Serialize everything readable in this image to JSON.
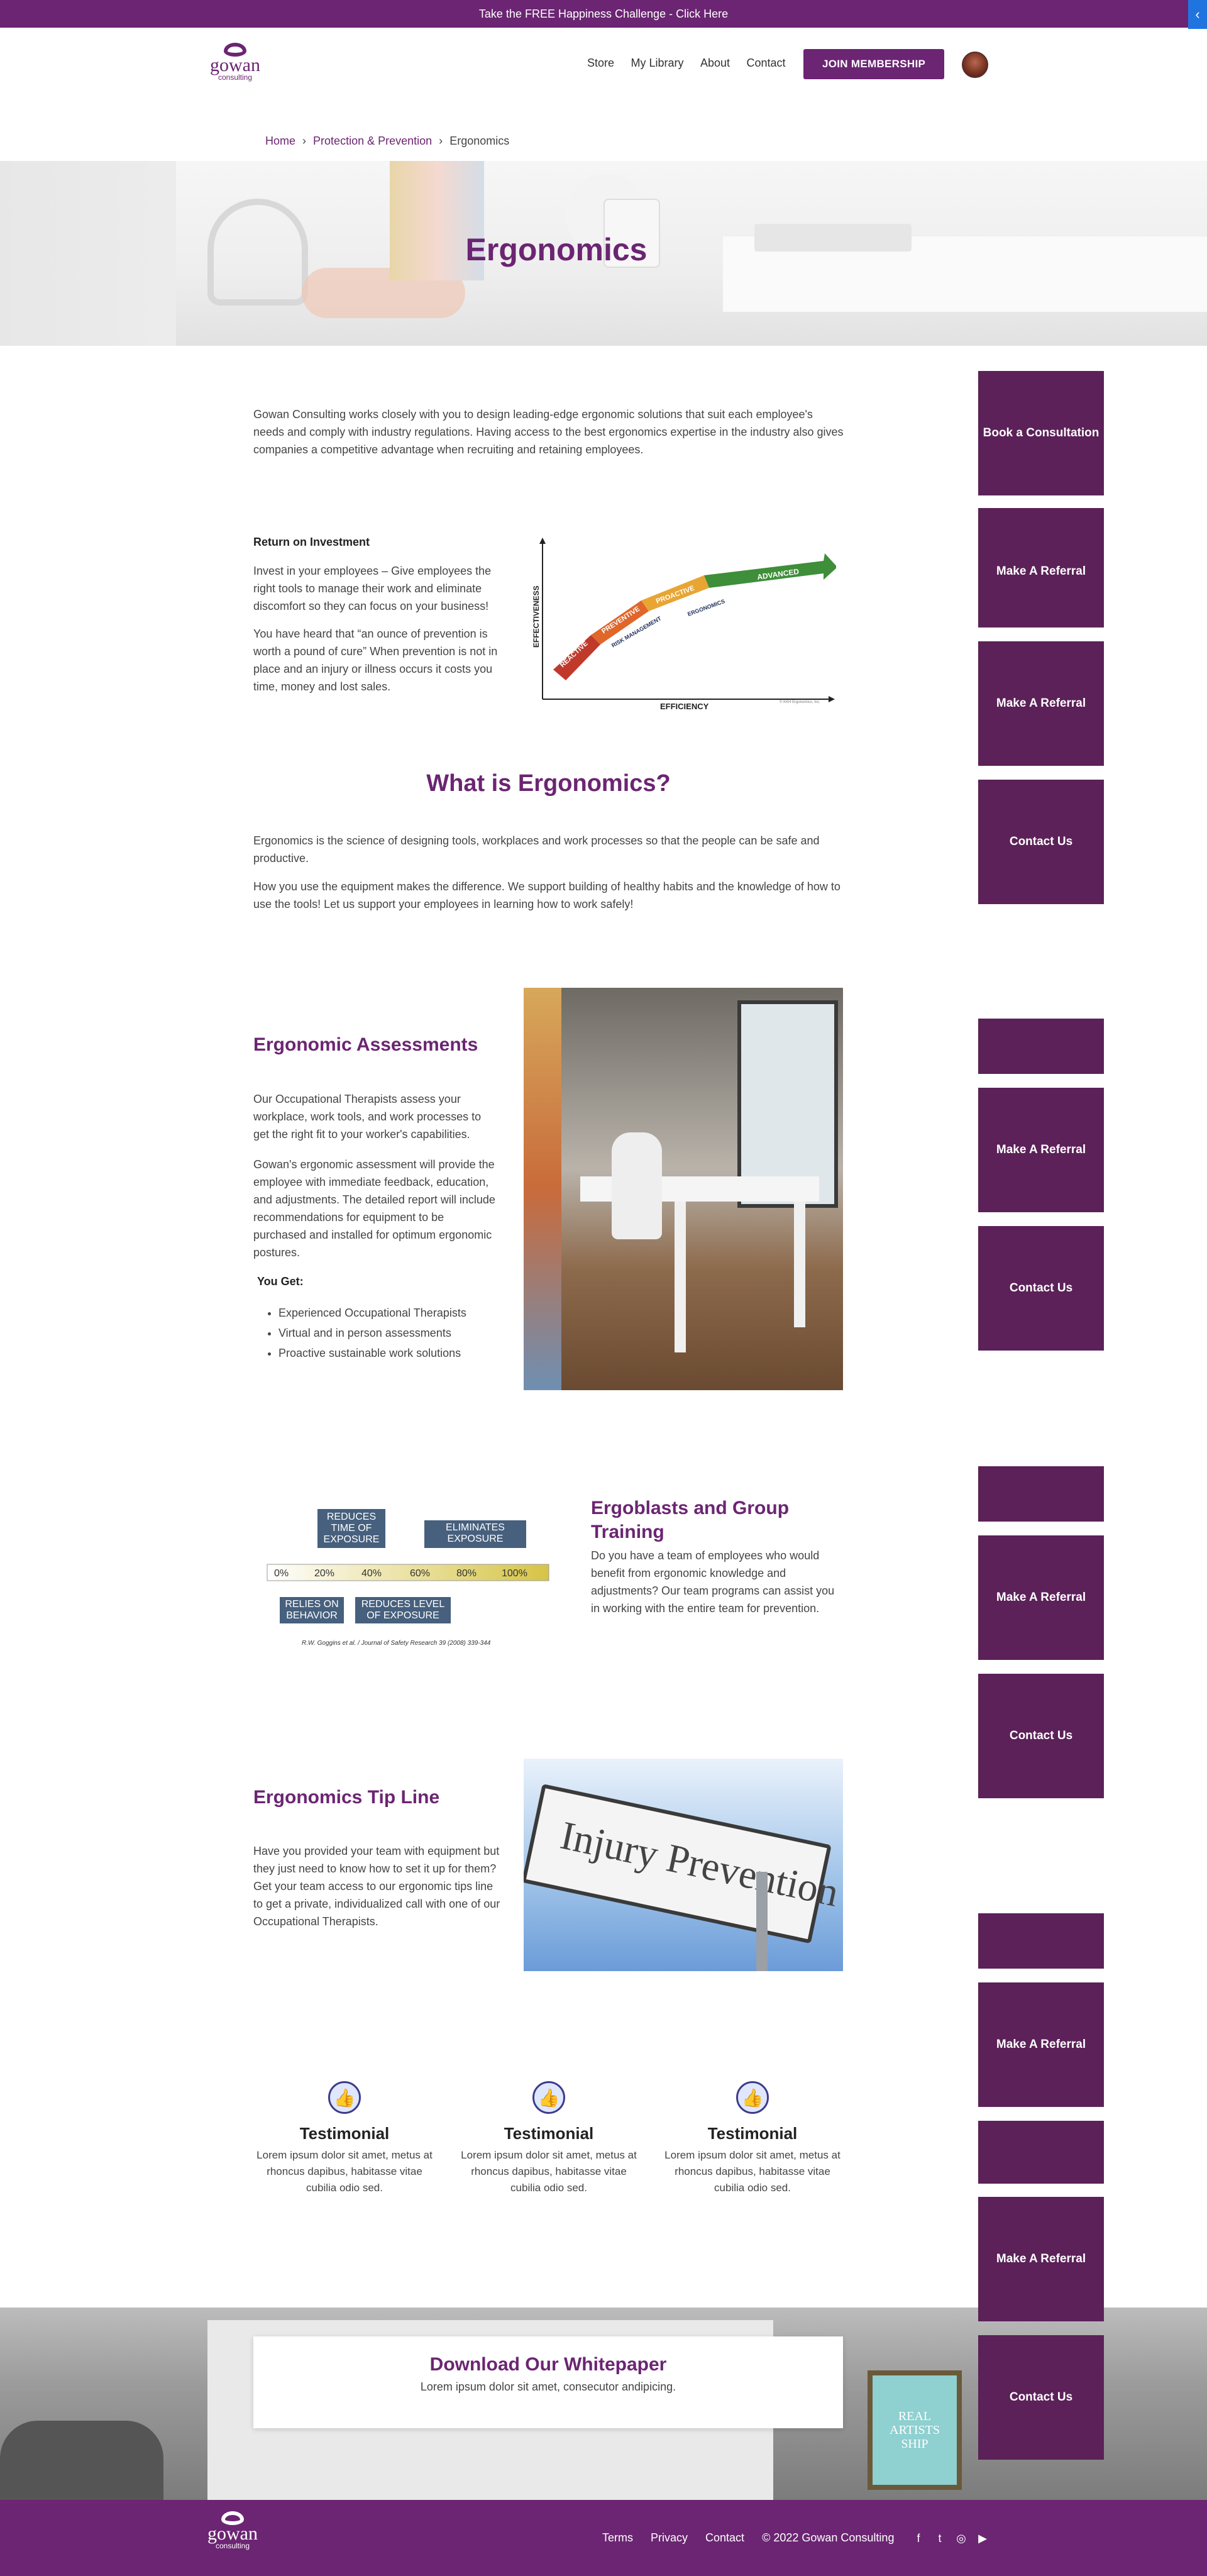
{
  "topbar": {
    "text": "Take the FREE Happiness Challenge - Click Here",
    "tab_glyph": "‹"
  },
  "logo": {
    "name": "gowan",
    "sub": "consulting"
  },
  "nav": {
    "items": [
      "Store",
      "My Library",
      "About",
      "Contact"
    ],
    "join_label": "JOIN MEMBERSHIP"
  },
  "breadcrumb": {
    "home": "Home",
    "parent": "Protection & Prevention",
    "current": "Ergonomics",
    "sep": "›"
  },
  "hero": {
    "title": "Ergonomics"
  },
  "intro": {
    "text": "Gowan Consulting works closely with you to design leading-edge ergonomic solutions that suit each employee's needs and comply with industry regulations. Having access to the best ergonomics expertise in the industry also gives companies a competitive advantage when recruiting and retaining employees."
  },
  "roi": {
    "heading": "Return on Investment",
    "p1": "Invest in your employees – Give employees the right tools to manage their work and eliminate discomfort so they can focus on your business!",
    "p2": "You have heard that “an ounce of prevention is worth a pound of cure”  When prevention is not in place and an injury or illness occurs it costs you time, money and lost sales.",
    "chart": {
      "ylabel": "EFFECTIVENESS",
      "xlabel": "EFFICIENCY",
      "stages": [
        "REACTIVE",
        "PREVENTIVE",
        "PROACTIVE",
        "ADVANCED"
      ],
      "tags": [
        "RISK MANAGEMENT",
        "ERGONOMICS"
      ],
      "credit": "© KKH Ergonomics, Inc."
    }
  },
  "what": {
    "title": "What is Ergonomics?",
    "p1": "Ergonomics is the science of designing tools, workplaces and work processes so that the people can be safe and productive.",
    "p2": "How you use the equipment makes the difference.  We support building of healthy habits and the knowledge of how to use the tools! Let us support your employees in learning how to work safely!"
  },
  "assess": {
    "title": "Ergonomic Assessments",
    "p1": "Our Occupational Therapists assess your workplace, work tools, and work processes to get the right fit to your worker's capabilities.",
    "p2": "Gowan's ergonomic assessment will provide the employee with immediate feedback, education, and adjustments.  The detailed report will include recommendations for equipment to be purchased and installed for optimum ergonomic postures.",
    "you_get": "You Get:",
    "bullets": [
      "Experienced Occupational Therapists",
      "Virtual and in person assessments",
      "Proactive sustainable work solutions"
    ]
  },
  "ergoblasts": {
    "title": "Ergoblasts and Group Training",
    "text": " Do you have a team of employees who would benefit from ergonomic knowledge and adjustments? Our team programs can assist you in working with the entire team for prevention.",
    "scale": [
      "0%",
      "20%",
      "40%",
      "60%",
      "80%",
      "100%"
    ],
    "boxes_top": [
      "REDUCES TIME OF EXPOSURE",
      "ELIMINATES EXPOSURE"
    ],
    "boxes_bottom": [
      "RELIES ON BEHAVIOR",
      "REDUCES LEVEL OF EXPOSURE"
    ],
    "citation": "R.W. Goggins et al. / Journal of Safety Research 39 (2008) 339-344"
  },
  "tipline": {
    "title": "Ergonomics Tip Line",
    "text": "Have you provided your team with equipment but they just need to know how to set it up for them?  Get your team access to our ergonomic tips line to get a private, individualized call with one of our Occupational Therapists.",
    "sign_text": "Injury Prevention"
  },
  "testimonials": [
    {
      "title": "Testimonial",
      "text": "Lorem ipsum dolor sit amet, metus at rhoncus dapibus, habitasse vitae cubilia odio sed."
    },
    {
      "title": "Testimonial",
      "text": "Lorem ipsum dolor sit amet, metus at rhoncus dapibus, habitasse vitae cubilia odio sed."
    },
    {
      "title": "Testimonial",
      "text": "Lorem ipsum dolor sit amet, metus at rhoncus dapibus, habitasse vitae cubilia odio sed."
    }
  ],
  "whitepaper": {
    "title": "Download Our Whitepaper",
    "text": "Lorem ipsum dolor sit amet, consecutor andipicing.",
    "poster": [
      "REAL",
      "ARTISTS",
      "SHIP"
    ]
  },
  "sidebar": {
    "book": "Book a Consultation",
    "referral": "Make A Referral",
    "contact": "Contact Us",
    "peek": "Make A Referral"
  },
  "footer": {
    "links": [
      "Terms",
      "Privacy",
      "Contact"
    ],
    "copyright": "© 2022 Gowan Consulting",
    "social": [
      "f",
      "t",
      "◎",
      "▶"
    ]
  },
  "colors": {
    "brand": "#6b2572",
    "sidebar": "#5b2158",
    "accent_blue": "#1f74e0"
  }
}
